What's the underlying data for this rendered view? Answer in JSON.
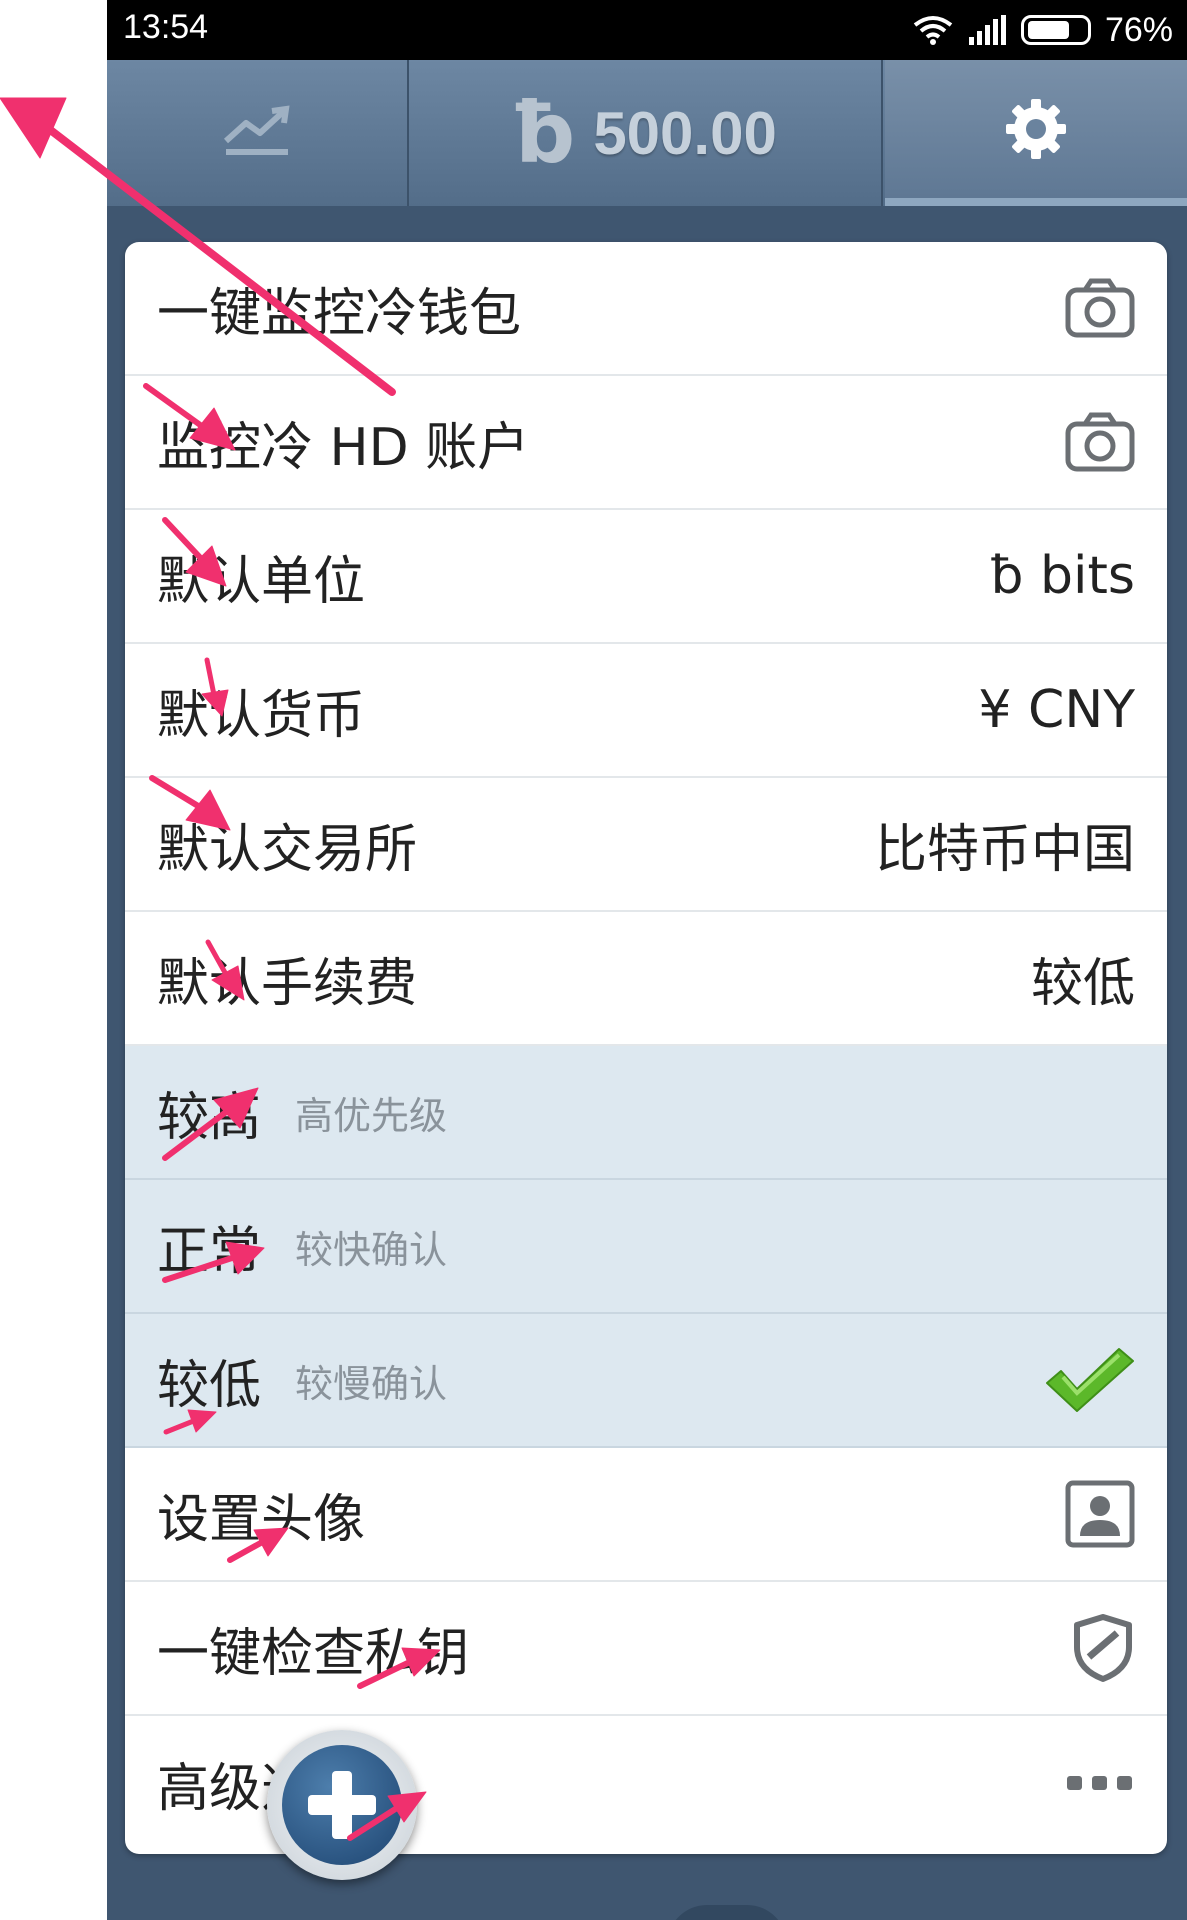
{
  "status_bar": {
    "time": "13:54",
    "battery_pct": "76%",
    "battery_level": 0.76
  },
  "tabbar": {
    "chart_icon": "chart-line-icon",
    "currency_symbol": "ƀ",
    "balance": "500.00",
    "settings_icon": "gear-icon"
  },
  "settings": [
    {
      "label": "一键监控冷钱包",
      "icon": "camera-icon"
    },
    {
      "label": "监控冷 HD 账户",
      "icon": "camera-icon"
    },
    {
      "label": "默认单位",
      "value": "ƀ bits"
    },
    {
      "label": "默认货币",
      "value": "¥ CNY"
    },
    {
      "label": "默认交易所",
      "value": "比特币中国"
    },
    {
      "label": "默认手续费",
      "value": "较低"
    }
  ],
  "fee_options": [
    {
      "label": "较高",
      "hint": "高优先级",
      "selected": false
    },
    {
      "label": "正常",
      "hint": "较快确认",
      "selected": false
    },
    {
      "label": "较低",
      "hint": "较慢确认",
      "selected": true
    }
  ],
  "more_settings": [
    {
      "label": "设置头像",
      "icon": "avatar-icon"
    },
    {
      "label": "一键检查私钥",
      "icon": "shield-icon"
    },
    {
      "label": "高级选项",
      "icon": "more-dots-icon"
    }
  ],
  "colors": {
    "accent_pink": "#f0306e",
    "header": "#5f7894",
    "check_green": "#5cb82a",
    "selected_row": "#dde8f0"
  }
}
